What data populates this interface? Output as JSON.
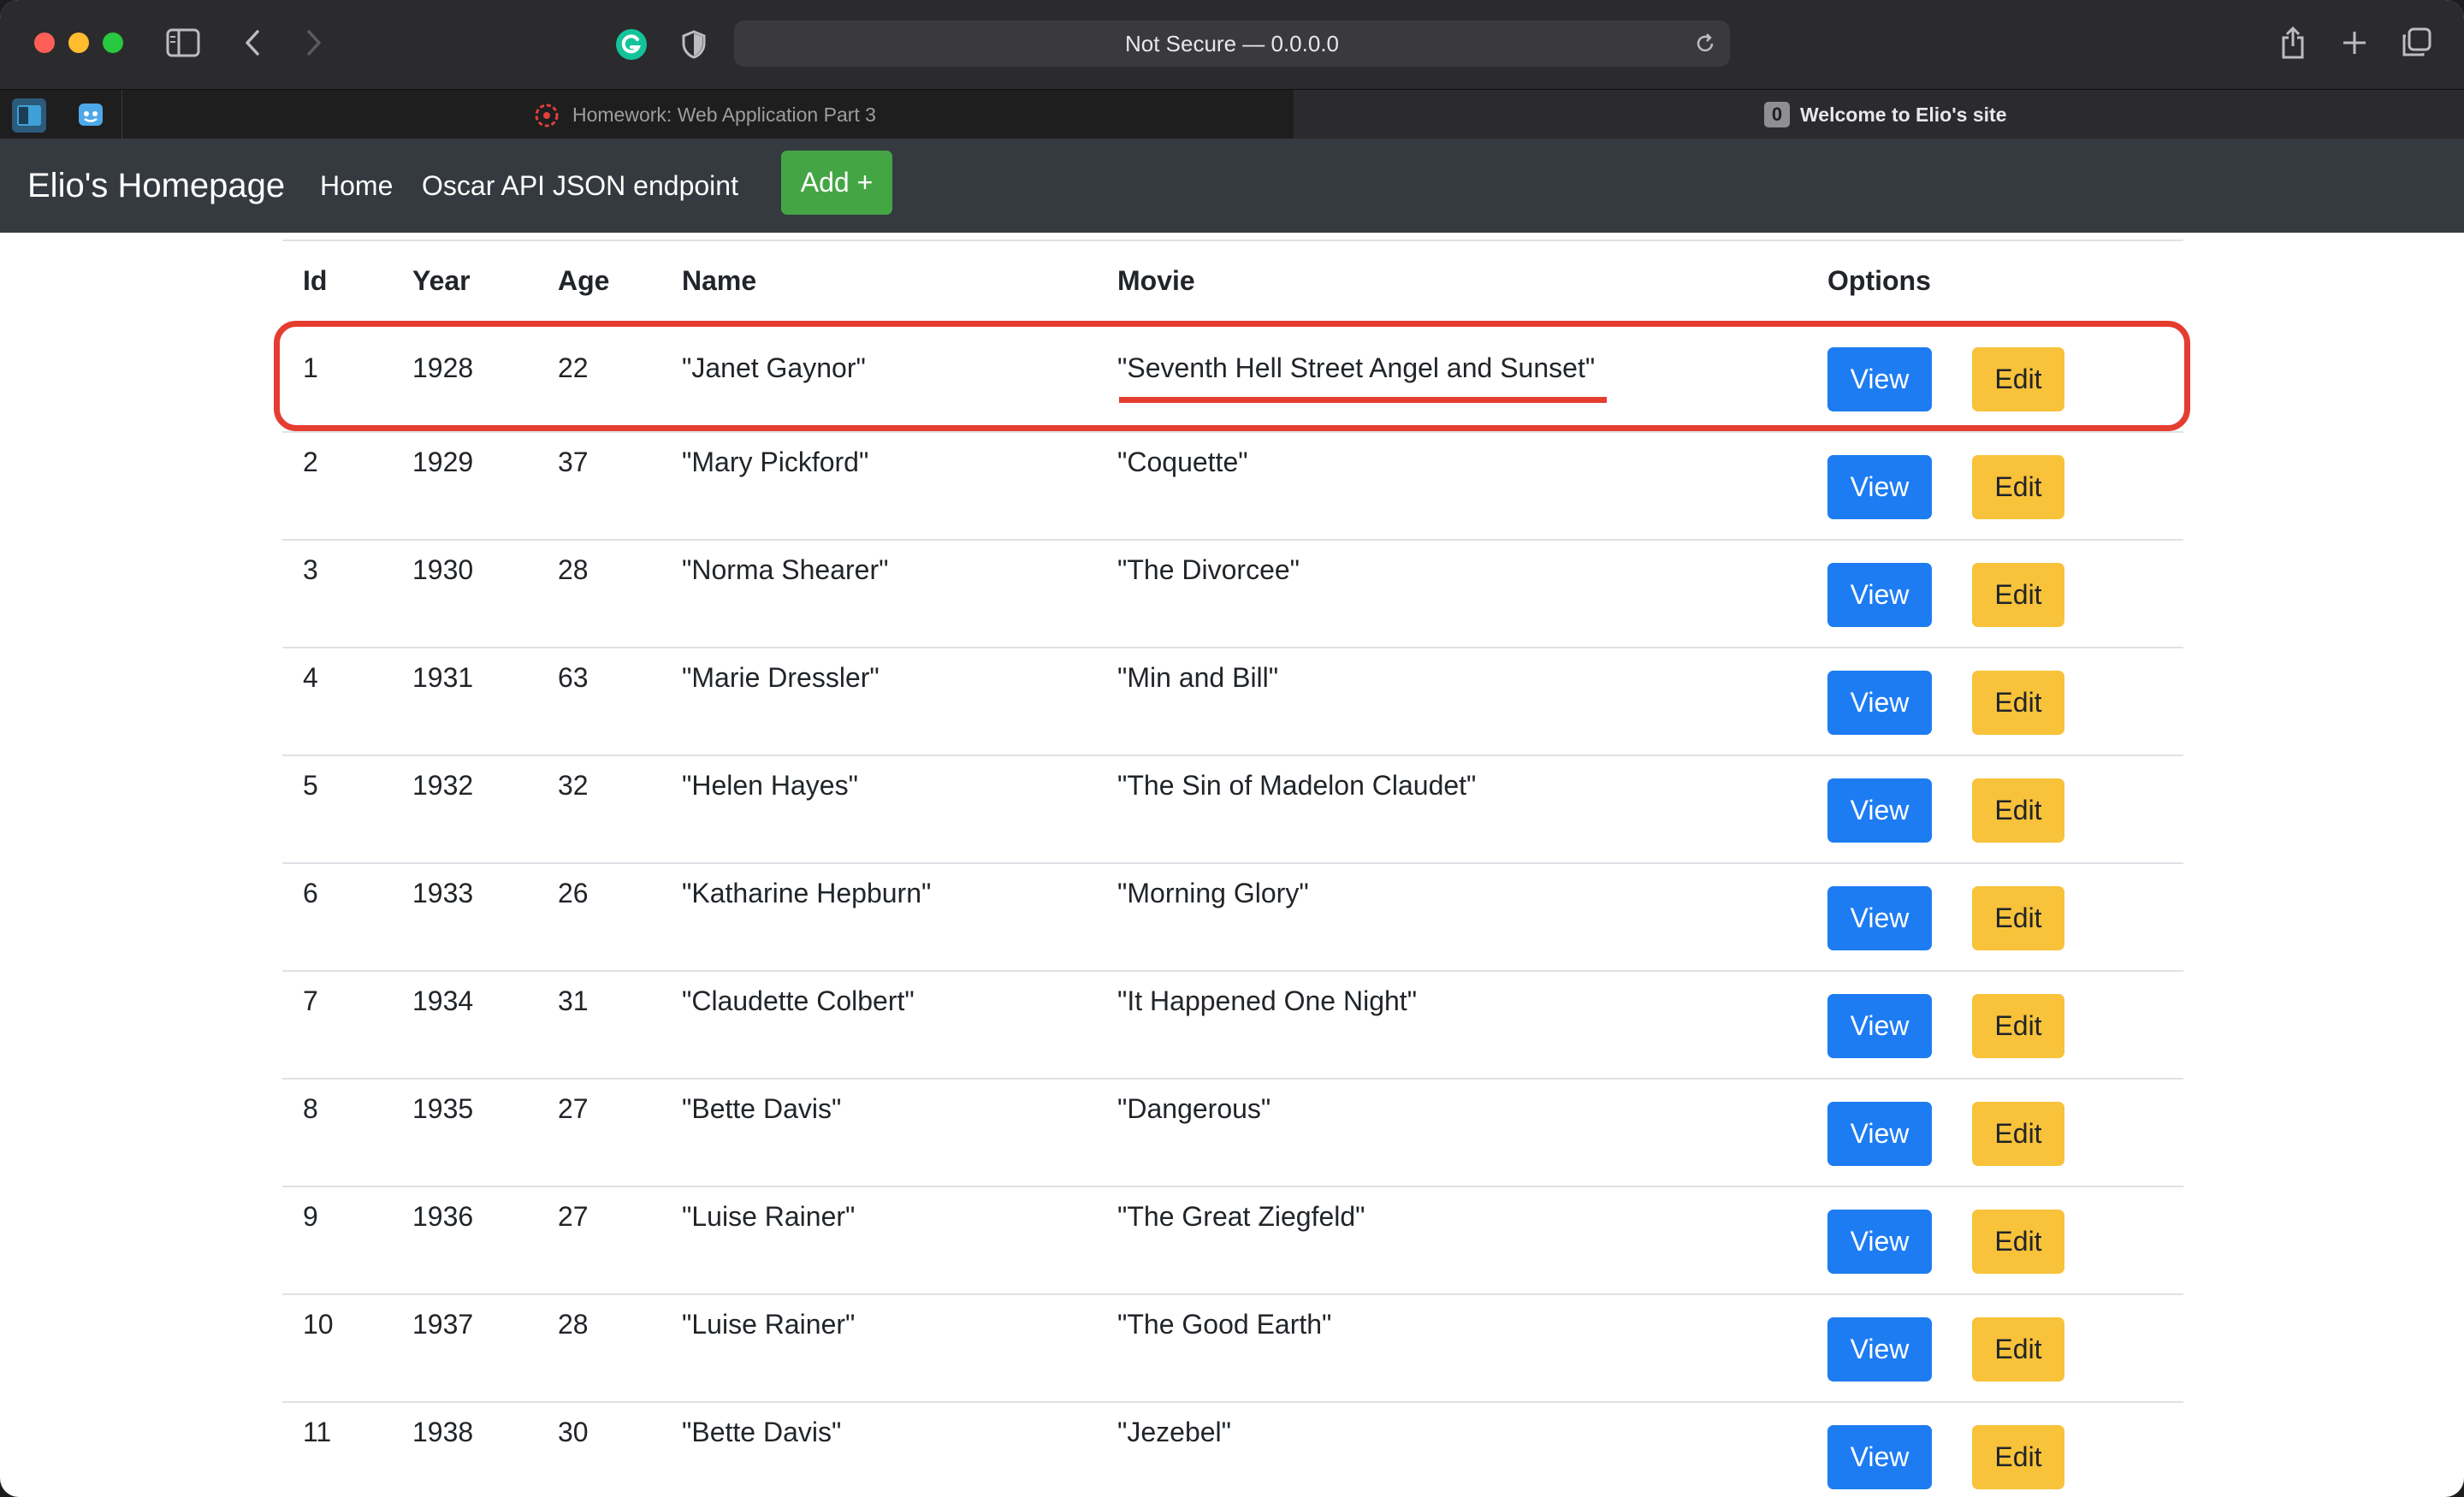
{
  "browser": {
    "address": "Not Secure — 0.0.0.0",
    "tabs": [
      {
        "label": "Homework: Web Application Part 3",
        "active": false
      },
      {
        "label": "Welcome to Elio's site",
        "badge": "0",
        "active": true
      }
    ]
  },
  "nav": {
    "brand": "Elio's Homepage",
    "links": [
      "Home",
      "Oscar API JSON endpoint"
    ],
    "add_label": "Add +"
  },
  "table": {
    "headers": {
      "id": "Id",
      "year": "Year",
      "age": "Age",
      "name": "Name",
      "movie": "Movie",
      "options": "Options"
    },
    "view_label": "View",
    "edit_label": "Edit",
    "rows": [
      {
        "id": "1",
        "year": "1928",
        "age": "22",
        "name": "\"Janet Gaynor\"",
        "movie": "\"Seventh Hell Street Angel and Sunset\""
      },
      {
        "id": "2",
        "year": "1929",
        "age": "37",
        "name": "\"Mary Pickford\"",
        "movie": "\"Coquette\""
      },
      {
        "id": "3",
        "year": "1930",
        "age": "28",
        "name": "\"Norma Shearer\"",
        "movie": "\"The Divorcee\""
      },
      {
        "id": "4",
        "year": "1931",
        "age": "63",
        "name": "\"Marie Dressler\"",
        "movie": "\"Min and Bill\""
      },
      {
        "id": "5",
        "year": "1932",
        "age": "32",
        "name": "\"Helen Hayes\"",
        "movie": "\"The Sin of Madelon Claudet\""
      },
      {
        "id": "6",
        "year": "1933",
        "age": "26",
        "name": "\"Katharine Hepburn\"",
        "movie": "\"Morning Glory\""
      },
      {
        "id": "7",
        "year": "1934",
        "age": "31",
        "name": "\"Claudette Colbert\"",
        "movie": "\"It Happened One Night\""
      },
      {
        "id": "8",
        "year": "1935",
        "age": "27",
        "name": "\"Bette Davis\"",
        "movie": "\"Dangerous\""
      },
      {
        "id": "9",
        "year": "1936",
        "age": "27",
        "name": "\"Luise Rainer\"",
        "movie": "\"The Great Ziegfeld\""
      },
      {
        "id": "10",
        "year": "1937",
        "age": "28",
        "name": "\"Luise Rainer\"",
        "movie": "\"The Good Earth\""
      },
      {
        "id": "11",
        "year": "1938",
        "age": "30",
        "name": "\"Bette Davis\"",
        "movie": "\"Jezebel\""
      }
    ]
  },
  "colors": {
    "navbar": "#343a40",
    "view_button": "#1d7cf2",
    "edit_button": "#f8c23a",
    "add_button": "#44a545",
    "highlight": "#e53d2f"
  }
}
